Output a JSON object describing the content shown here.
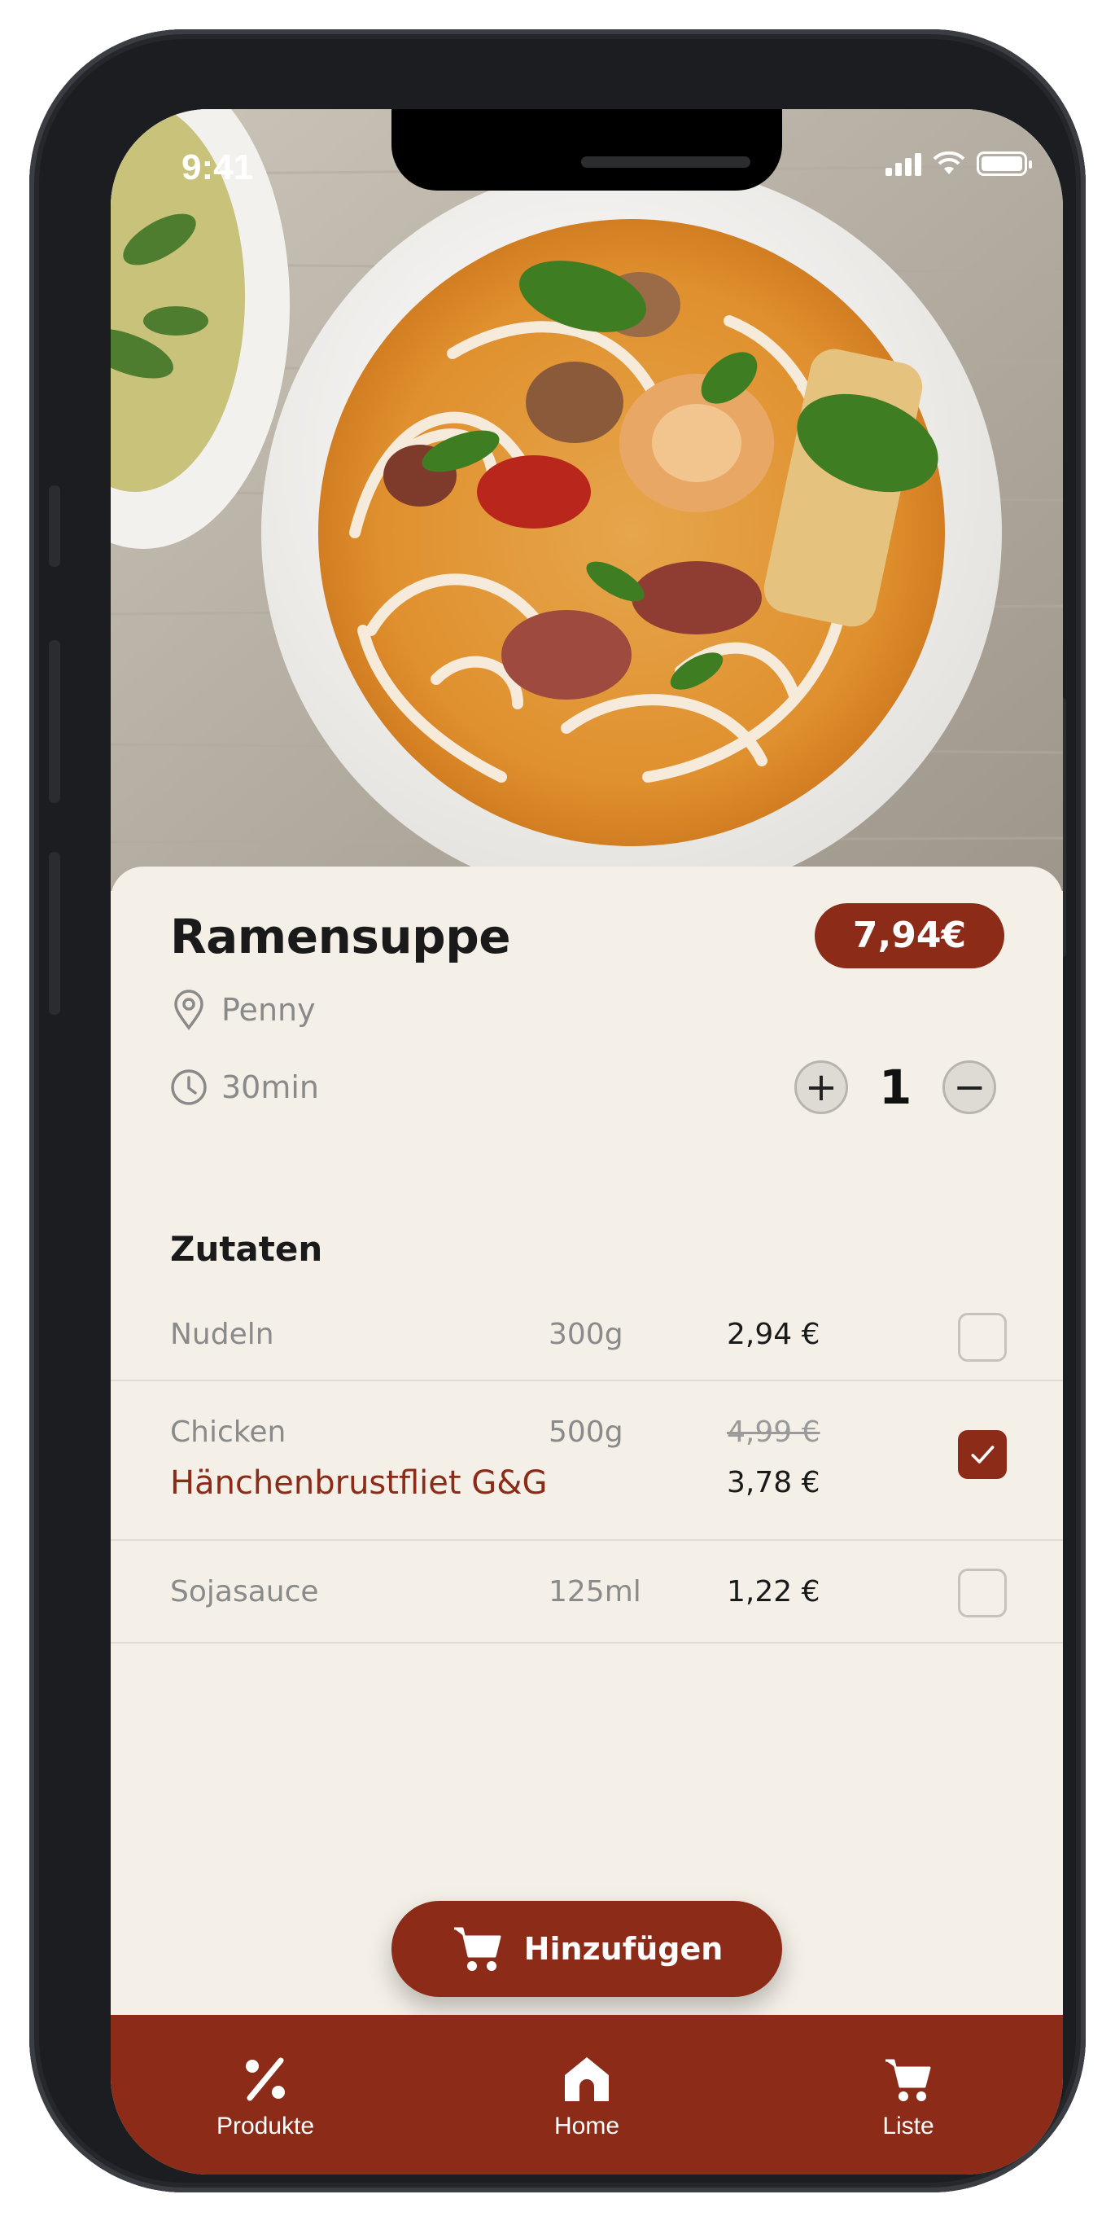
{
  "status_bar": {
    "time": "9:41"
  },
  "product": {
    "title": "Ramensuppe",
    "price": "7,94€",
    "store": "Penny",
    "duration": "30min",
    "quantity": "1",
    "quantity_increase": "+",
    "quantity_decrease": "−"
  },
  "ingredients": {
    "heading": "Zutaten",
    "items": [
      {
        "name": "Nudeln",
        "amount": "300g",
        "price": "2,94 €",
        "checked": false
      },
      {
        "name": "Chicken",
        "amount": "500g",
        "old_price": "4,99 €",
        "alternative": "Hänchenbrustfliet G&G",
        "price": "3,78 €",
        "checked": true
      },
      {
        "name": "Sojasauce",
        "amount": "125ml",
        "price": "1,22 €",
        "checked": false
      }
    ]
  },
  "actions": {
    "add_label": "Hinzufügen"
  },
  "nav": {
    "items": [
      {
        "label": "Produkte",
        "icon": "percent-icon"
      },
      {
        "label": "Home",
        "icon": "home-icon"
      },
      {
        "label": "Liste",
        "icon": "cart-icon"
      }
    ]
  },
  "colors": {
    "accent": "#8b2b18",
    "card_background": "#f4f0e8",
    "muted_text": "#8a8a8a"
  }
}
